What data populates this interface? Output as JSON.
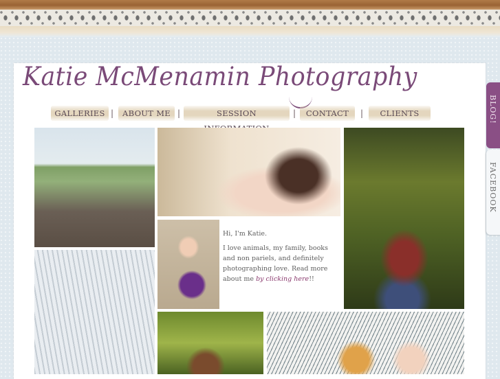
{
  "site": {
    "title": "Katie McMenamin Photography"
  },
  "nav": {
    "items": [
      {
        "label": "GALLERIES"
      },
      {
        "label": "ABOUT ME"
      },
      {
        "label": "SESSION INFORMATION"
      },
      {
        "label": "CONTACT"
      },
      {
        "label": "CLIENTS"
      }
    ],
    "separator": "|"
  },
  "side_tabs": {
    "blog": "BLOG!",
    "facebook": "FACEBOOK"
  },
  "intro": {
    "greeting": "Hi, I'm Katie.",
    "body_prefix": "I love animals, my family, books and non pariels, and definitely photographing love. Read more about me ",
    "link_text": "by clicking here",
    "suffix": "!!"
  },
  "colors": {
    "brand_purple": "#7a4a78",
    "tab_purple": "#8a4f85",
    "link": "#8a3a6e",
    "nav_ribbon": "#e2d4ba"
  }
}
